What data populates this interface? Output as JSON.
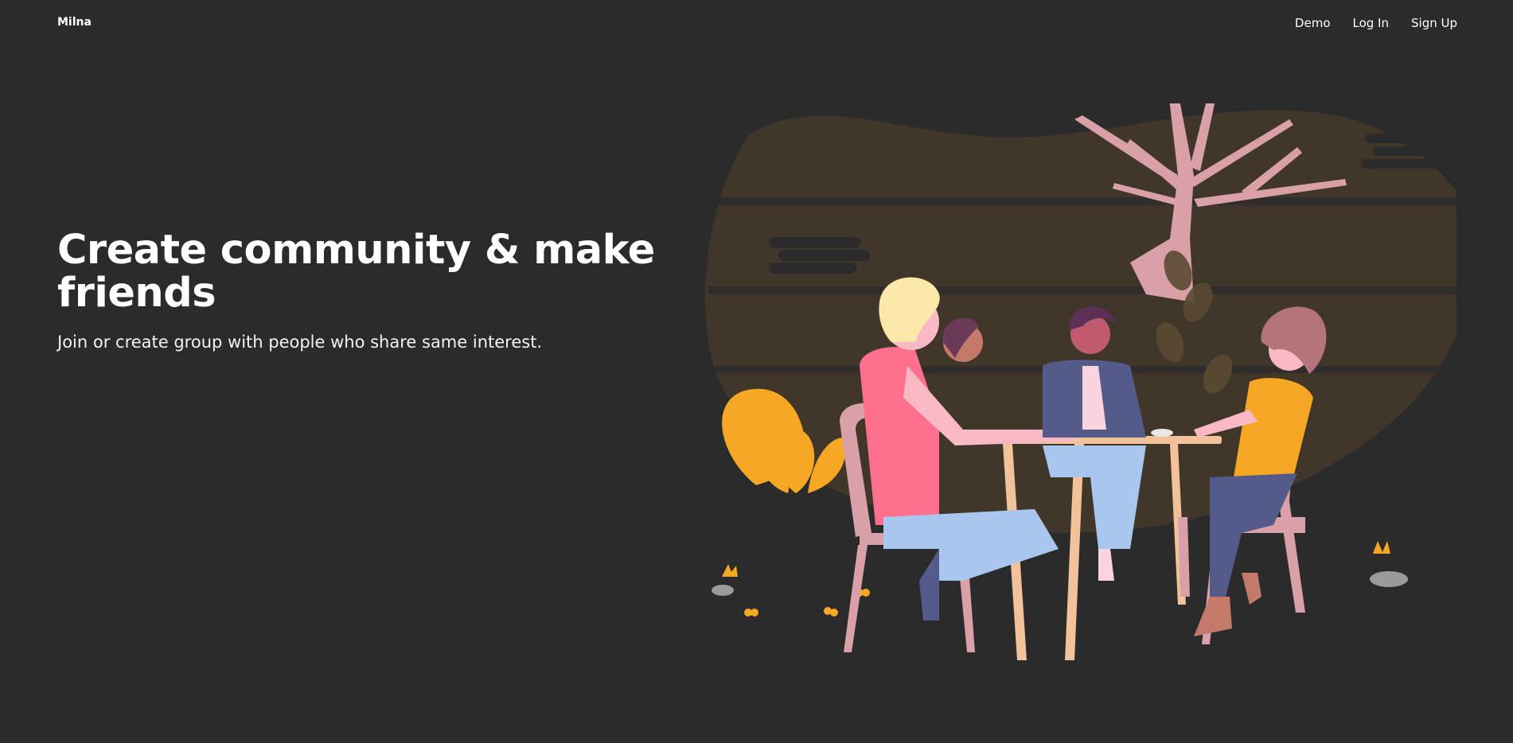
{
  "header": {
    "brand": "Milna",
    "nav": [
      {
        "label": "Demo"
      },
      {
        "label": "Log In"
      },
      {
        "label": "Sign Up"
      }
    ]
  },
  "hero": {
    "title": "Create community & make friends",
    "subtitle": "Join or create group with people who share same interest."
  },
  "colors": {
    "background": "#2b2b2b",
    "blob": "#40362a",
    "accent_yellow": "#f6a723",
    "tree_pink": "#d9a0a8",
    "shirt_pink": "#ff6f8e",
    "jeans_blue": "#a9c6ef",
    "jacket_navy": "#545a8a"
  },
  "illustration": {
    "icon": "friends-at-cafe-table-illustration"
  }
}
